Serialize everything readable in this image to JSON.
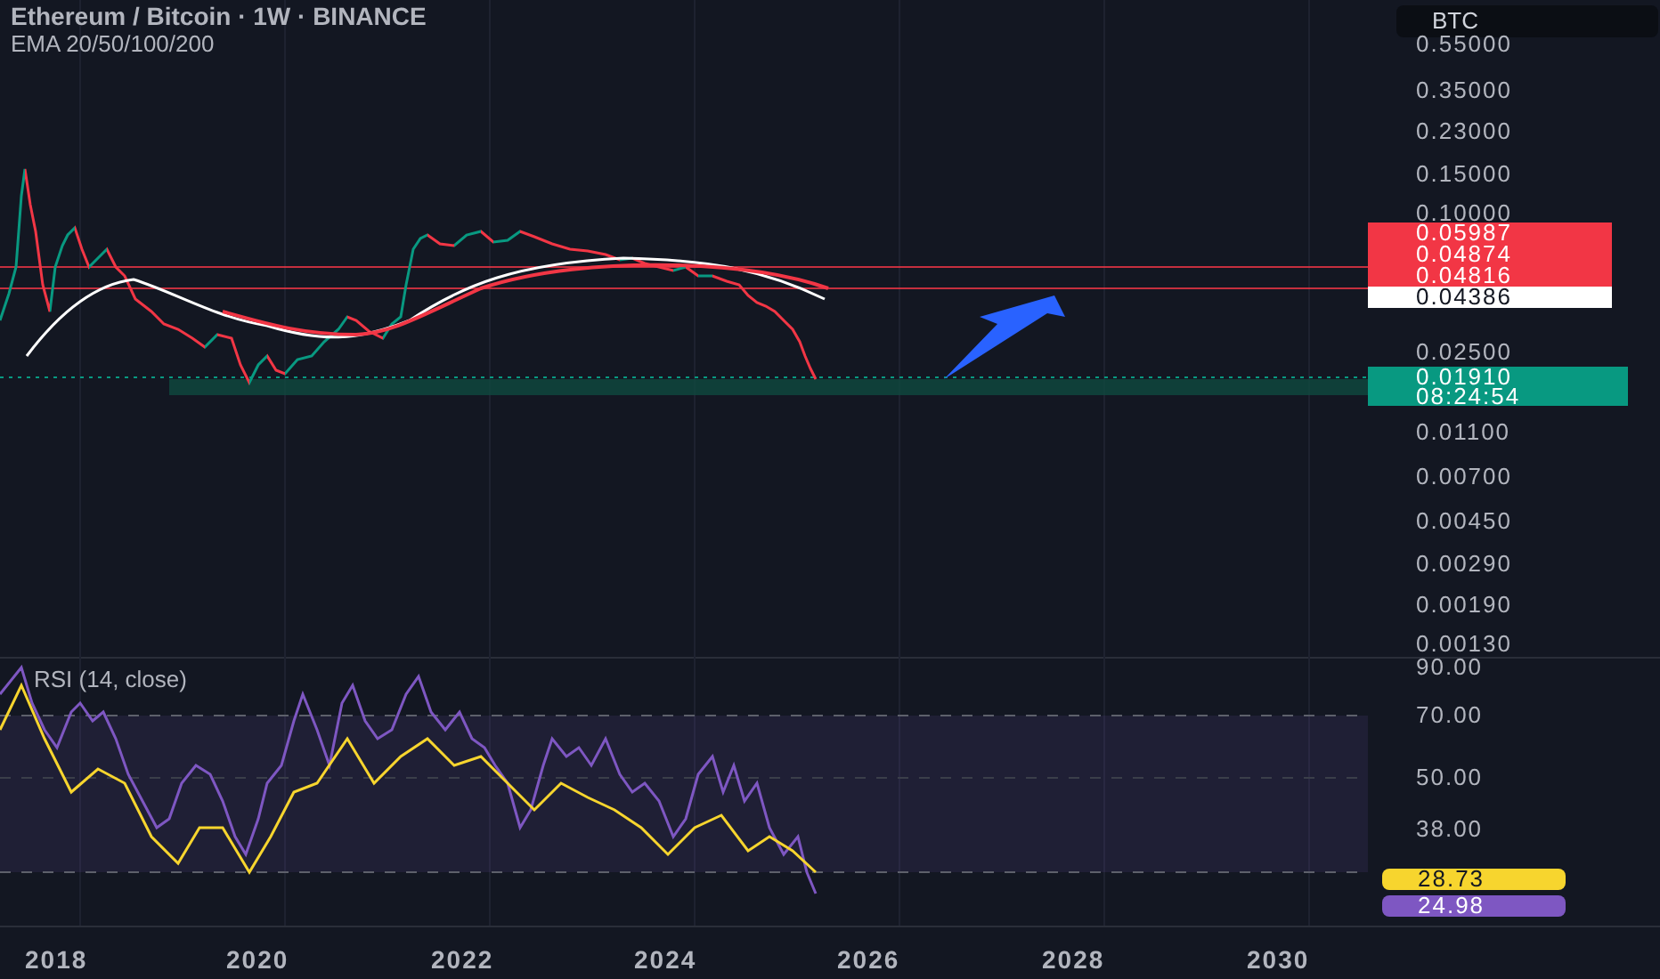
{
  "header": {
    "title": "Ethereum / Bitcoin · 1W · BINANCE",
    "indicator": "EMA 20/50/100/200"
  },
  "currency_button": "BTC",
  "price_scale": [
    "0.55000",
    "0.35000",
    "0.23000",
    "0.15000",
    "0.10000",
    "0.02500",
    "0.01100",
    "0.00700",
    "0.00450",
    "0.00290",
    "0.00190",
    "0.00130"
  ],
  "price_tags": [
    {
      "value": "0.05987",
      "color": "#f23645"
    },
    {
      "value": "0.04874",
      "color": "#f23645"
    },
    {
      "value": "0.04816",
      "color": "#f23645"
    },
    {
      "value": "0.04386",
      "color": "#ffffff"
    }
  ],
  "last_price": {
    "value": "0.01910",
    "countdown": "08:24:54",
    "color": "#089981"
  },
  "rsi": {
    "title": "RSI (14, close)",
    "scale": [
      "90.00",
      "70.00",
      "50.00",
      "38.00"
    ],
    "tags": [
      {
        "value": "28.73",
        "color": "#f7d52e"
      },
      {
        "value": "24.98",
        "color": "#7e57c2"
      }
    ]
  },
  "time_axis": [
    "2018",
    "2020",
    "2022",
    "2024",
    "2026",
    "2028",
    "2030"
  ]
}
